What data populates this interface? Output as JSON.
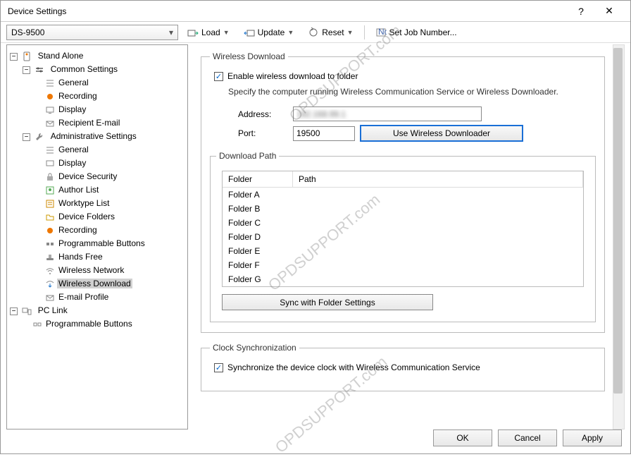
{
  "window": {
    "title": "Device Settings",
    "help": "?",
    "close": "✕"
  },
  "device_select": {
    "value": "DS-9500"
  },
  "toolbar": {
    "load": "Load",
    "update": "Update",
    "reset": "Reset",
    "setjob": "Set Job Number..."
  },
  "tree": {
    "standalone": "Stand Alone",
    "common": "Common Settings",
    "common_items": {
      "general": "General",
      "recording": "Recording",
      "display": "Display",
      "email": "Recipient E-mail"
    },
    "admin": "Administrative Settings",
    "admin_items": {
      "general": "General",
      "display": "Display",
      "security": "Device Security",
      "author": "Author List",
      "worktype": "Worktype List",
      "folders": "Device Folders",
      "recording": "Recording",
      "progbtn": "Programmable Buttons",
      "handsfree": "Hands Free",
      "wnet": "Wireless Network",
      "wdown": "Wireless Download",
      "eprofile": "E-mail Profile"
    },
    "pclink": "PC Link",
    "pclink_items": {
      "progbtn": "Programmable Buttons"
    }
  },
  "panel": {
    "wd_legend": "Wireless Download",
    "enable_label": "Enable wireless download to folder",
    "desc": "Specify the computer running Wireless Communication Service or Wireless Downloader.",
    "address_lbl": "Address:",
    "address_val": "192.168.99.1",
    "port_lbl": "Port:",
    "port_val": "19500",
    "use_btn": "Use Wireless Downloader",
    "dp_legend": "Download Path",
    "dp_hdr_folder": "Folder",
    "dp_hdr_path": "Path",
    "folders": [
      "Folder A",
      "Folder B",
      "Folder C",
      "Folder D",
      "Folder E",
      "Folder F",
      "Folder G"
    ],
    "sync_btn": "Sync with Folder Settings",
    "cs_legend": "Clock Synchronization",
    "cs_label": "Synchronize the device clock with Wireless Communication Service"
  },
  "buttons": {
    "ok": "OK",
    "cancel": "Cancel",
    "apply": "Apply"
  },
  "watermark": "OPDSUPPORT.com"
}
